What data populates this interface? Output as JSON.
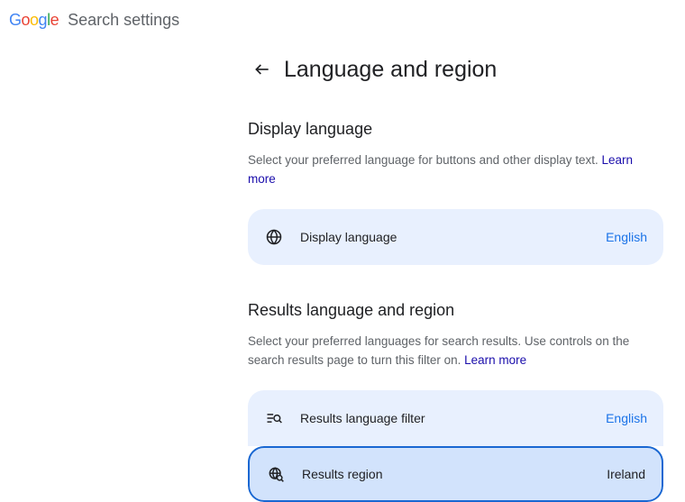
{
  "header": {
    "app_title": "Search settings"
  },
  "page": {
    "title": "Language and region"
  },
  "display_language": {
    "section_title": "Display language",
    "description": "Select your preferred language for buttons and other display text. ",
    "learn_more": "Learn more",
    "card_label": "Display language",
    "card_value": "English"
  },
  "results": {
    "section_title": "Results language and region",
    "description": "Select your preferred languages for search results. Use controls on the search results page to turn this filter on. ",
    "learn_more": "Learn more",
    "filter_label": "Results language filter",
    "filter_value": "English",
    "region_label": "Results region",
    "region_value": "Ireland"
  }
}
